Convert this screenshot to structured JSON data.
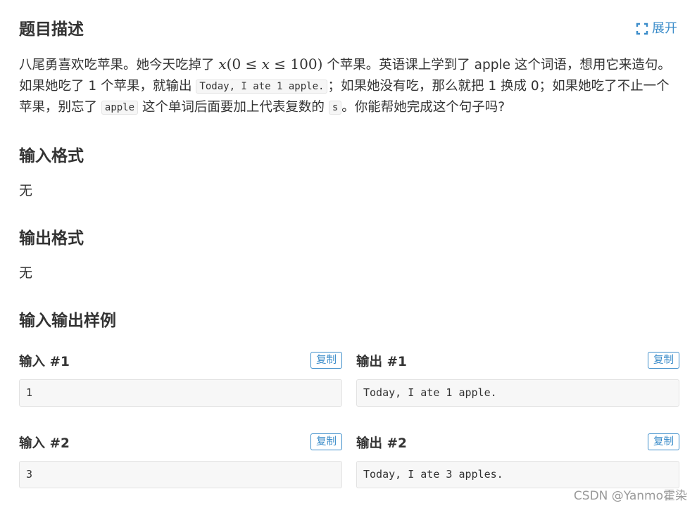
{
  "description": {
    "title": "题目描述",
    "expand_label": "展开",
    "text_1": "八尾勇喜欢吃苹果。她今天吃掉了 ",
    "math_x": "x",
    "math_open": "(0 ≤ ",
    "math_x2": "x",
    "math_close": " ≤ 100)",
    "text_2": " 个苹果。英语课上学到了 apple 这个词语，想用它来造句。如果她吃了 1 个苹果，就输出 ",
    "code_1": "Today, I ate 1 apple.",
    "text_3": "；如果她没有吃，那么就把 1 换成 0；如果她吃了不止一个苹果，别忘了 ",
    "code_2": "apple",
    "text_4": " 这个单词后面要加上代表复数的 ",
    "code_3": "s",
    "text_5": "。你能帮她完成这个句子吗?"
  },
  "input_format": {
    "title": "输入格式",
    "text": "无"
  },
  "output_format": {
    "title": "输出格式",
    "text": "无"
  },
  "samples": {
    "title": "输入输出样例",
    "copy_label": "复制",
    "items": [
      {
        "input_label": "输入 #1",
        "input": "1",
        "output_label": "输出 #1",
        "output": "Today, I ate 1 apple."
      },
      {
        "input_label": "输入 #2",
        "input": "3",
        "output_label": "输出 #2",
        "output": "Today, I ate 3 apples."
      }
    ]
  },
  "watermark": "CSDN @Yanmo霍染",
  "colors": {
    "accent": "#3c8dca",
    "text": "#333333",
    "code_bg": "#f7f7f7"
  },
  "icons": {
    "expand": "expand-brackets-icon"
  }
}
